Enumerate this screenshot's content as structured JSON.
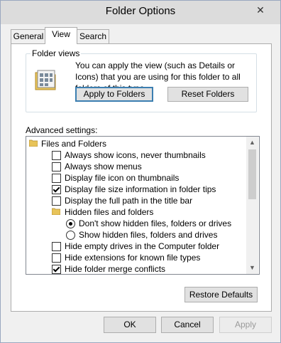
{
  "window": {
    "title": "Folder Options",
    "close_glyph": "✕"
  },
  "tabs": [
    {
      "label": "General",
      "active": false
    },
    {
      "label": "View",
      "active": true
    },
    {
      "label": "Search",
      "active": false
    }
  ],
  "folder_views": {
    "legend": "Folder views",
    "description": "You can apply the view (such as Details or Icons) that you are using for this folder to all folders of this type.",
    "apply_button": "Apply to Folders",
    "reset_button": "Reset Folders"
  },
  "advanced": {
    "label": "Advanced settings:",
    "items": [
      {
        "type": "folder",
        "label": "Files and Folders",
        "indent": 0
      },
      {
        "type": "checkbox",
        "label": "Always show icons, never thumbnails",
        "checked": false,
        "indent": 1
      },
      {
        "type": "checkbox",
        "label": "Always show menus",
        "checked": false,
        "indent": 1
      },
      {
        "type": "checkbox",
        "label": "Display file icon on thumbnails",
        "checked": false,
        "indent": 1
      },
      {
        "type": "checkbox",
        "label": "Display file size information in folder tips",
        "checked": true,
        "indent": 1
      },
      {
        "type": "checkbox",
        "label": "Display the full path in the title bar",
        "checked": false,
        "indent": 1
      },
      {
        "type": "folder",
        "label": "Hidden files and folders",
        "indent": 1
      },
      {
        "type": "radio",
        "label": "Don't show hidden files, folders or drives",
        "checked": true,
        "indent": 2
      },
      {
        "type": "radio",
        "label": "Show hidden files, folders and drives",
        "checked": false,
        "indent": 2
      },
      {
        "type": "checkbox",
        "label": "Hide empty drives in the Computer folder",
        "checked": false,
        "indent": 1
      },
      {
        "type": "checkbox",
        "label": "Hide extensions for known file types",
        "checked": false,
        "indent": 1
      },
      {
        "type": "checkbox",
        "label": "Hide folder merge conflicts",
        "checked": true,
        "indent": 1
      }
    ]
  },
  "restore_button": "Restore Defaults",
  "footer": {
    "ok": "OK",
    "cancel": "Cancel",
    "apply": "Apply"
  },
  "icons": {
    "scroll_up": "scroll-up-icon",
    "scroll_down": "scroll-down-icon"
  }
}
